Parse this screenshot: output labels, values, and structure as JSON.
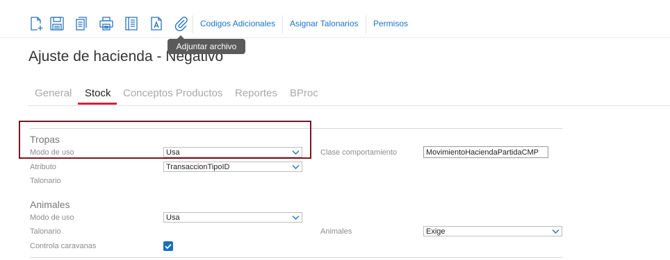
{
  "toolbar": {
    "icons": [
      "new-document-icon",
      "save-icon",
      "copy-icon",
      "print-icon",
      "document-list-icon",
      "text-document-icon",
      "attach-file-icon"
    ],
    "links": [
      "Codigos Adicionales",
      "Asignar Talonarios",
      "Permisos"
    ],
    "tooltip": "Adjuntar archivo"
  },
  "page": {
    "title": "Ajuste de hacienda - Negativo"
  },
  "tabs": [
    "General",
    "Stock",
    "Conceptos Productos",
    "Reportes",
    "BProc"
  ],
  "active_tab": "Stock",
  "tropas": {
    "title": "Tropas",
    "modo_de_uso_label": "Modo de uso",
    "modo_de_uso_value": "Usa",
    "atributo_label": "Atributo",
    "atributo_value": "TransaccionTipoID",
    "talonario_label": "Talonario",
    "clase_label": "Clase comportamiento",
    "clase_value": "MovimientoHaciendaPartidaCMP"
  },
  "animales": {
    "title": "Animales",
    "modo_de_uso_label": "Modo de uso",
    "modo_de_uso_value": "Usa",
    "talonario_label": "Talonario",
    "animales_label": "Animales",
    "animales_value": "Exige",
    "caravanas_label": "Controla caravanas",
    "caravanas_checked": true
  },
  "colors": {
    "accent": "#1a73c9",
    "tab_underline": "#d21f3c",
    "highlight": "#7a1420",
    "checkbox": "#1a6fc1"
  }
}
